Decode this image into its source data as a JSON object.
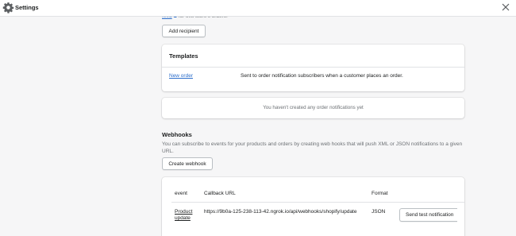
{
  "topbar": {
    "title": "Settings",
    "settings_icon": "gear-icon",
    "close_icon": "close-icon"
  },
  "recipients": {
    "link_text": "feed",
    "link_icon": "external-link-icon",
    "suffix": "for this store's orders.",
    "add_button": "Add recipient"
  },
  "templates": {
    "title": "Templates",
    "items": [
      {
        "name": "New order",
        "description": "Sent to order notification subscribers when a customer places an order."
      }
    ]
  },
  "notifications_empty": "You haven't created any order notifications yet",
  "webhooks": {
    "title": "Webhooks",
    "description": "You can subscribe to events for your products and orders by creating web hooks that will push XML or JSON notifications to a given URL.",
    "create_button": "Create webhook",
    "columns": [
      "event",
      "Callback URL",
      "Format"
    ],
    "rows": [
      {
        "event_line1": "Product",
        "event_line2": "update",
        "url": "https://9b0a-125-238-113-42.ngrok.io/api/webhooks/shopify/update",
        "format": "JSON",
        "action": "Send test notification"
      }
    ]
  },
  "colors": {
    "link": "#2c6ecb",
    "background": "#f6f6f7",
    "subdued_text": "#6d7175"
  }
}
